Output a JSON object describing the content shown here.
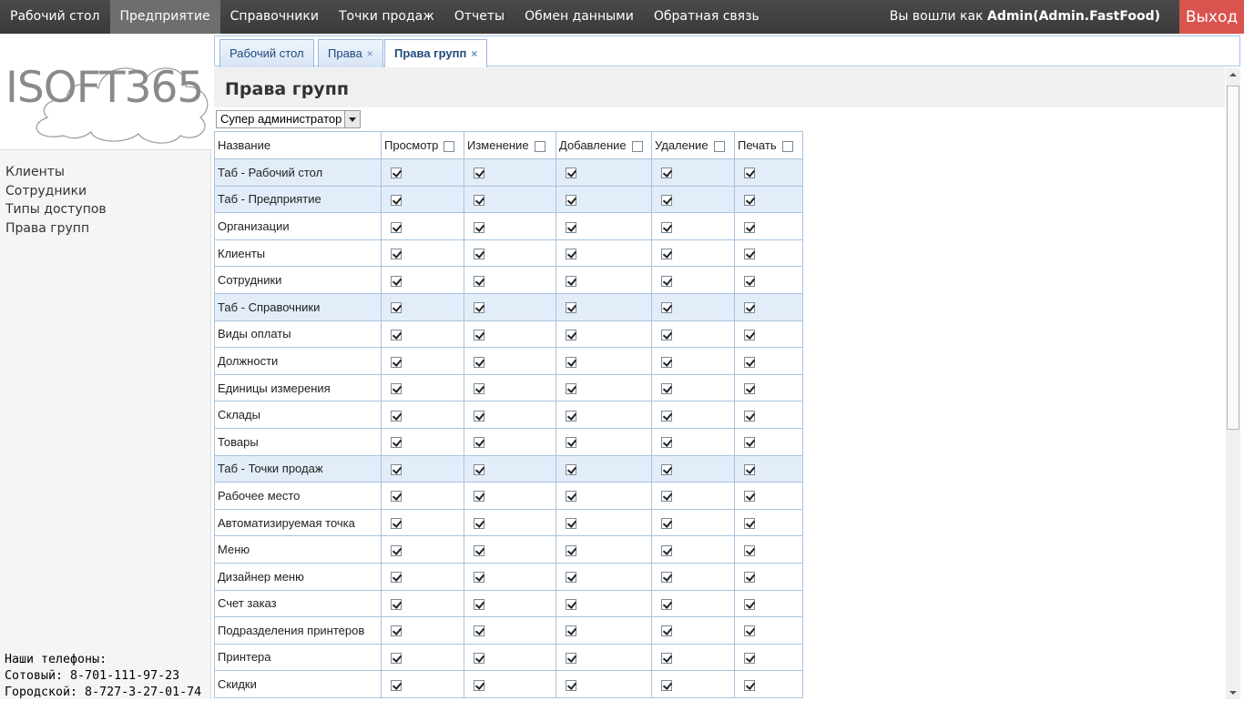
{
  "topnav": {
    "items": [
      "Рабочий стол",
      "Предприятие",
      "Справочники",
      "Точки продаж",
      "Отчеты",
      "Обмен данными",
      "Обратная связь"
    ],
    "active_index": 1,
    "login_prefix": "Вы вошли как",
    "login_user": "Admin(Admin.FastFood)",
    "logout_label": "Выход"
  },
  "sidebar": {
    "logo_text": "ISOFT365",
    "items": [
      "Клиенты",
      "Сотрудники",
      "Типы доступов",
      "Права групп"
    ],
    "phones_title": "Наши телефоны:",
    "phone_mobile": "Сотовый: 8-701-111-97-23",
    "phone_city": "Городской: 8-727-3-27-01-74"
  },
  "tabs": [
    {
      "label": "Рабочий стол",
      "closable": false
    },
    {
      "label": "Права",
      "closable": true
    },
    {
      "label": "Права групп",
      "closable": true,
      "active": true
    }
  ],
  "tab_close_glyph": "×",
  "page": {
    "title": "Права групп",
    "group_select_value": "Супер администратор"
  },
  "table": {
    "headers": [
      "Название",
      "Просмотр",
      "Изменение",
      "Добавление",
      "Удаление",
      "Печать"
    ],
    "rows": [
      {
        "name": "Таб - Рабочий стол",
        "tab": true
      },
      {
        "name": "Таб - Предприятие",
        "tab": true
      },
      {
        "name": "Организации",
        "tab": false
      },
      {
        "name": "Клиенты",
        "tab": false
      },
      {
        "name": "Сотрудники",
        "tab": false
      },
      {
        "name": "Таб - Справочники",
        "tab": true
      },
      {
        "name": "Виды оплаты",
        "tab": false
      },
      {
        "name": "Должности",
        "tab": false
      },
      {
        "name": "Единицы измерения",
        "tab": false
      },
      {
        "name": "Склады",
        "tab": false
      },
      {
        "name": "Товары",
        "tab": false
      },
      {
        "name": "Таб - Точки продаж",
        "tab": true
      },
      {
        "name": "Рабочее место",
        "tab": false
      },
      {
        "name": "Автоматизируемая точка",
        "tab": false
      },
      {
        "name": "Меню",
        "tab": false
      },
      {
        "name": "Дизайнер меню",
        "tab": false
      },
      {
        "name": "Счет заказ",
        "tab": false
      },
      {
        "name": "Подразделения принтеров",
        "tab": false
      },
      {
        "name": "Принтера",
        "tab": false
      },
      {
        "name": "Скидки",
        "tab": false
      }
    ]
  },
  "colors": {
    "topbar": "#3f3f3f",
    "active_nav": "#6e6e6e",
    "logout": "#d9534f",
    "tab_row": "#e3edf9",
    "table_border": "#a9c3de"
  }
}
